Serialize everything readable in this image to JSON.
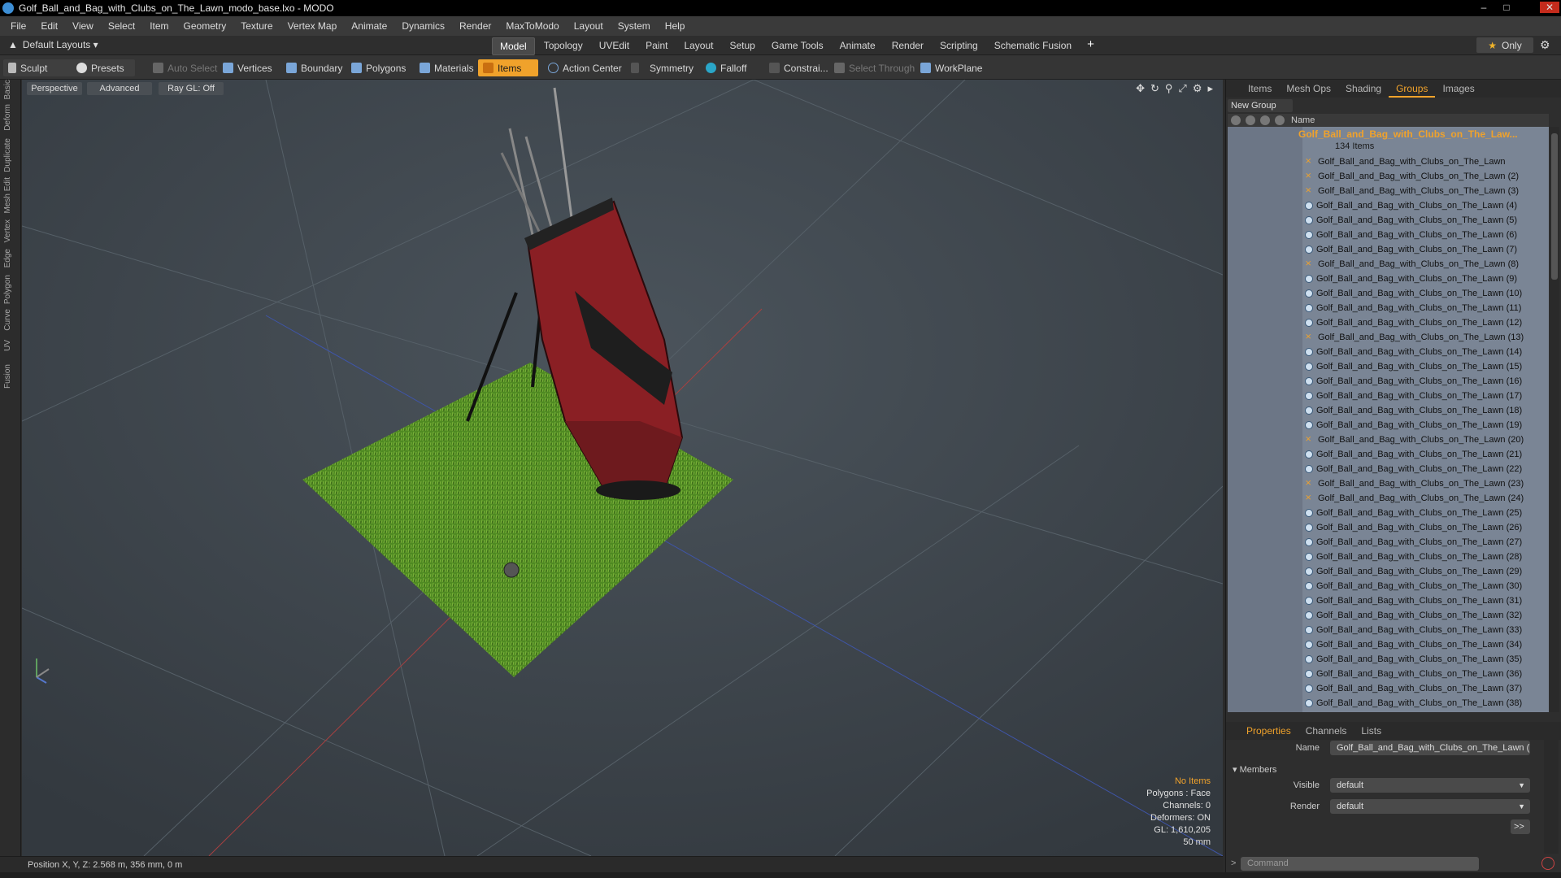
{
  "window": {
    "title": "Golf_Ball_and_Bag_with_Clubs_on_The_Lawn_modo_base.lxo - MODO",
    "minimize": "–",
    "maximize": "□",
    "close": "✕"
  },
  "menu": [
    "File",
    "Edit",
    "View",
    "Select",
    "Item",
    "Geometry",
    "Texture",
    "Vertex Map",
    "Animate",
    "Dynamics",
    "Render",
    "MaxToModo",
    "Layout",
    "System",
    "Help"
  ],
  "layouts": {
    "label": "Default Layouts ▾",
    "tabs": [
      "Model",
      "Topology",
      "UVEdit",
      "Paint",
      "Layout",
      "Setup",
      "Game Tools",
      "Animate",
      "Render",
      "Scripting",
      "Schematic Fusion"
    ],
    "active": "Model",
    "plus": "+",
    "only": "Only"
  },
  "toolbar": {
    "sculpt": "Sculpt",
    "presets": "Presets",
    "auto_select": "Auto Select",
    "vertices": "Vertices",
    "boundary": "Boundary",
    "polygons": "Polygons",
    "materials": "Materials",
    "items": "Items",
    "action_center": "Action Center",
    "symmetry": "Symmetry",
    "falloff": "Falloff",
    "constrain": "Constrai...",
    "select_through": "Select Through",
    "workplane": "WorkPlane"
  },
  "left_tabs": [
    "Basic",
    "Deform",
    "Duplicate",
    "Mesh Edit",
    "Vertex",
    "Edge",
    "Polygon",
    "Curve",
    "UV",
    "Fusion"
  ],
  "viewport": {
    "view": "Perspective",
    "shading": "Advanced",
    "raygl": "Ray GL: Off"
  },
  "hud": {
    "items": "No Items",
    "polygons": "Polygons : Face",
    "channels": "Channels: 0",
    "deformers": "Deformers: ON",
    "gl": "GL: 1,610,205",
    "scale": "50 mm"
  },
  "status": {
    "position": "Position X, Y, Z:   2.568 m, 356 mm, 0 m"
  },
  "right_panel": {
    "tabs": [
      "Items",
      "Mesh Ops",
      "Shading",
      "Groups",
      "Images"
    ],
    "active": "Groups",
    "new_group": "New Group",
    "name_header": "Name",
    "group_name": "Golf_Ball_and_Bag_with_Clubs_on_The_Law...",
    "group_count": "134 Items",
    "rows": [
      "Golf_Ball_and_Bag_with_Clubs_on_The_Lawn",
      "Golf_Ball_and_Bag_with_Clubs_on_The_Lawn (2)",
      "Golf_Ball_and_Bag_with_Clubs_on_The_Lawn (3)",
      "Golf_Ball_and_Bag_with_Clubs_on_The_Lawn (4)",
      "Golf_Ball_and_Bag_with_Clubs_on_The_Lawn (5)",
      "Golf_Ball_and_Bag_with_Clubs_on_The_Lawn (6)",
      "Golf_Ball_and_Bag_with_Clubs_on_The_Lawn (7)",
      "Golf_Ball_and_Bag_with_Clubs_on_The_Lawn (8)",
      "Golf_Ball_and_Bag_with_Clubs_on_The_Lawn (9)",
      "Golf_Ball_and_Bag_with_Clubs_on_The_Lawn (10)",
      "Golf_Ball_and_Bag_with_Clubs_on_The_Lawn (11)",
      "Golf_Ball_and_Bag_with_Clubs_on_The_Lawn (12)",
      "Golf_Ball_and_Bag_with_Clubs_on_The_Lawn (13)",
      "Golf_Ball_and_Bag_with_Clubs_on_The_Lawn (14)",
      "Golf_Ball_and_Bag_with_Clubs_on_The_Lawn (15)",
      "Golf_Ball_and_Bag_with_Clubs_on_The_Lawn (16)",
      "Golf_Ball_and_Bag_with_Clubs_on_The_Lawn (17)",
      "Golf_Ball_and_Bag_with_Clubs_on_The_Lawn (18)",
      "Golf_Ball_and_Bag_with_Clubs_on_The_Lawn (19)",
      "Golf_Ball_and_Bag_with_Clubs_on_The_Lawn (20)",
      "Golf_Ball_and_Bag_with_Clubs_on_The_Lawn (21)",
      "Golf_Ball_and_Bag_with_Clubs_on_The_Lawn (22)",
      "Golf_Ball_and_Bag_with_Clubs_on_The_Lawn (23)",
      "Golf_Ball_and_Bag_with_Clubs_on_The_Lawn (24)",
      "Golf_Ball_and_Bag_with_Clubs_on_The_Lawn (25)",
      "Golf_Ball_and_Bag_with_Clubs_on_The_Lawn (26)",
      "Golf_Ball_and_Bag_with_Clubs_on_The_Lawn (27)",
      "Golf_Ball_and_Bag_with_Clubs_on_The_Lawn (28)",
      "Golf_Ball_and_Bag_with_Clubs_on_The_Lawn (29)",
      "Golf_Ball_and_Bag_with_Clubs_on_The_Lawn (30)",
      "Golf_Ball_and_Bag_with_Clubs_on_The_Lawn (31)",
      "Golf_Ball_and_Bag_with_Clubs_on_The_Lawn (32)",
      "Golf_Ball_and_Bag_with_Clubs_on_The_Lawn (33)",
      "Golf_Ball_and_Bag_with_Clubs_on_The_Lawn (34)",
      "Golf_Ball_and_Bag_with_Clubs_on_The_Lawn (35)",
      "Golf_Ball_and_Bag_with_Clubs_on_The_Lawn (36)",
      "Golf_Ball_and_Bag_with_Clubs_on_The_Lawn (37)",
      "Golf_Ball_and_Bag_with_Clubs_on_The_Lawn (38)"
    ],
    "row_icons": [
      "locator",
      "locator",
      "locator",
      "mesh",
      "mesh",
      "mesh",
      "mesh",
      "locator",
      "mesh",
      "mesh",
      "mesh",
      "mesh",
      "locator",
      "mesh",
      "mesh",
      "mesh",
      "mesh",
      "mesh",
      "mesh",
      "locator",
      "mesh",
      "mesh",
      "locator",
      "locator",
      "mesh",
      "mesh",
      "mesh",
      "mesh",
      "mesh",
      "mesh",
      "mesh",
      "mesh",
      "mesh",
      "mesh",
      "mesh",
      "mesh",
      "mesh",
      "mesh"
    ]
  },
  "properties": {
    "tabs": [
      "Properties",
      "Channels",
      "Lists"
    ],
    "active": "Properties",
    "name_label": "Name",
    "name_value": "Golf_Ball_and_Bag_with_Clubs_on_The_Lawn (",
    "members": "Members",
    "visible_label": "Visible",
    "visible_value": "default",
    "render_label": "Render",
    "render_value": "default",
    "more": ">>",
    "command_placeholder": "Command"
  },
  "colors": {
    "accent": "#f0a22b",
    "grass": "#5a8a2a",
    "bag": "#8a1f24"
  }
}
